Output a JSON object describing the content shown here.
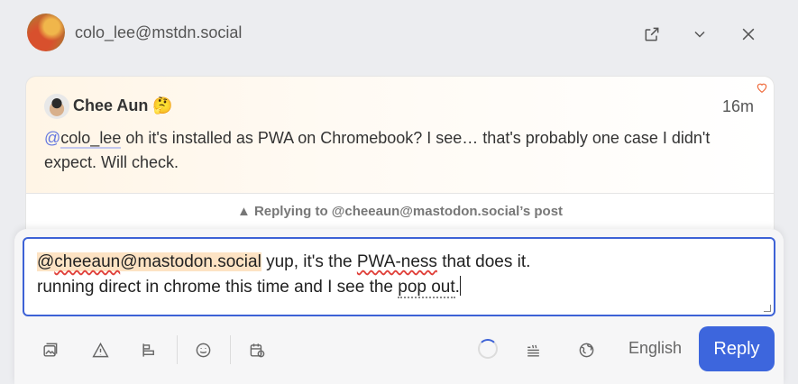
{
  "header": {
    "account": "colo_lee@mstdn.social",
    "icons": [
      "popout-icon",
      "chevron-down-icon",
      "close-icon"
    ]
  },
  "status": {
    "author": "Chee Aun",
    "author_emoji": "🤔",
    "time": "16m",
    "mention_at": "@",
    "mention_handle": "colo_lee",
    "text": " oh it's installed as PWA on Chromebook? I see… that's probably one case I didn't expect. Will check.",
    "favourite_icon": "heart-icon",
    "accent": "#ef6a3a"
  },
  "reply_context": "▲ Replying to @cheeaun@mastodon.social’s post",
  "compose": {
    "mention_at": "@",
    "mention_handle": "cheeaun",
    "mention_domain": "@mastodon.social",
    "line1_a": " yup, it's the ",
    "line1_spell": "PWA-ness",
    "line1_b": " that does it.",
    "line2_a": "running direct in chrome this time and I see the ",
    "line2_grammar": "pop out",
    "line2_b": ".",
    "toolbar_icons": [
      "media-icon",
      "warning-icon",
      "poll-icon",
      "emoji-icon",
      "schedule-icon",
      "loading-spinner",
      "text-format-icon",
      "globe-icon"
    ],
    "language": "English",
    "reply_label": "Reply",
    "accent": "#3d66dd"
  }
}
